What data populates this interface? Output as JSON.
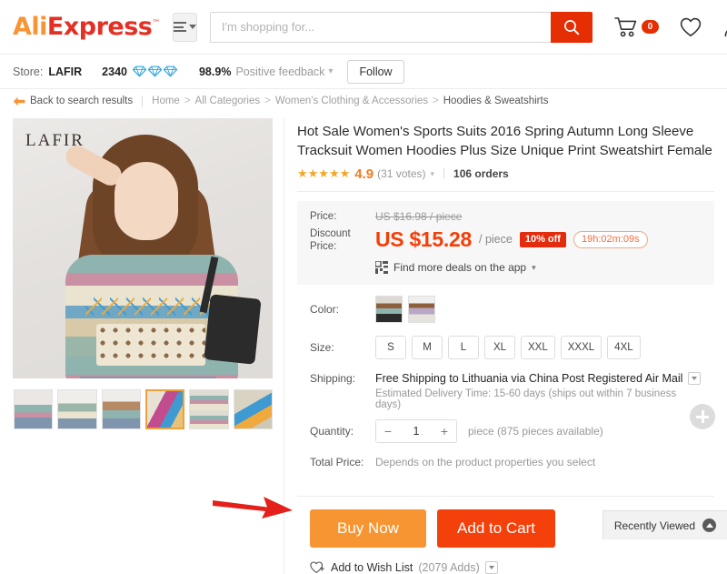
{
  "header": {
    "logo_ali": "Ali",
    "logo_express": "Express",
    "logo_tm": "™",
    "categories_icon": "hamburger-menu-icon",
    "search": {
      "placeholder": "I'm shopping for...",
      "value": "",
      "button_icon": "search-icon"
    },
    "cart": {
      "icon": "cart-icon",
      "count": "0"
    },
    "wishlist_icon": "heart-icon",
    "account_icon": "user-icon"
  },
  "store_bar": {
    "store_label": "Store:",
    "store_name": "LAFIR",
    "score": "2340",
    "diamond_icon": "diamond-icon",
    "diamond_count": 3,
    "feedback_percent": "98.9%",
    "feedback_text": "Positive feedback",
    "feedback_caret": "chevron-down-icon",
    "follow_label": "Follow"
  },
  "breadcrumb": {
    "back_icon": "back-arrow-icon",
    "back_label": "Back to search results",
    "items": [
      {
        "label": "Home"
      },
      {
        "label": "All Categories"
      },
      {
        "label": "Women's Clothing & Accessories"
      },
      {
        "label": "Hoodies & Sweatshirts"
      }
    ],
    "separator": ">"
  },
  "gallery": {
    "watermark": "LAFIR",
    "main_image_alt": "woman-wearing-striped-print-sweatshirt",
    "thumbnails": [
      {
        "name": "thumb-model-front",
        "selected": false
      },
      {
        "name": "thumb-model-sunglasses",
        "selected": false
      },
      {
        "name": "thumb-model-side",
        "selected": false
      },
      {
        "name": "thumb-fabric-detail",
        "selected": true
      },
      {
        "name": "thumb-flatlay-sweatshirt",
        "selected": false
      },
      {
        "name": "thumb-print-closeup",
        "selected": false
      }
    ]
  },
  "product": {
    "title": "Hot Sale Women's Sports Suits 2016 Spring Autumn Long Sleeve Tracksuit Women Hoodies Plus Size Unique Print Sweatshirt Female",
    "stars": "★★★★★",
    "rating": "4.9",
    "votes": "(31 votes)",
    "votes_caret": "chevron-down-icon",
    "orders": "106 orders",
    "price": {
      "price_label": "Price:",
      "original": "US $16.98 / piece",
      "discount_label_line1": "Discount",
      "discount_label_line2": "Price:",
      "amount": "US $15.28",
      "unit": "/ piece",
      "off_badge": "10% off",
      "countdown": "19h:02m:09s",
      "app_deal_icon": "qr-code-icon",
      "app_deal_text": "Find more deals on the app",
      "app_deal_caret": "caret-down-icon"
    },
    "color": {
      "label": "Color:",
      "options": [
        {
          "name": "color-swatch-dark-bag"
        },
        {
          "name": "color-swatch-light"
        }
      ]
    },
    "size": {
      "label": "Size:",
      "options": [
        "S",
        "M",
        "L",
        "XL",
        "XXL",
        "XXXL",
        "4XL"
      ]
    },
    "shipping": {
      "label": "Shipping:",
      "method": "Free Shipping to Lithuania via China Post Registered Air Mail",
      "dropdown_icon": "chevron-down-icon",
      "estimate": "Estimated Delivery Time: 15-60 days (ships out within 7 business days)"
    },
    "quantity": {
      "label": "Quantity:",
      "minus_icon": "minus-icon",
      "value": "1",
      "plus_icon": "plus-icon",
      "availability": "piece (875 pieces available)"
    },
    "total_price": {
      "label": "Total Price:",
      "value": "Depends on the product properties you select"
    },
    "actions": {
      "buy_now": "Buy Now",
      "add_to_cart": "Add to Cart",
      "wish_icon": "heart-plus-icon",
      "wish_label": "Add to Wish List",
      "wish_count": "(2079 Adds)",
      "wish_caret_icon": "chevron-down-icon"
    }
  },
  "floating": {
    "expand_button_icon": "plus-icon"
  },
  "recently_viewed": {
    "label": "Recently Viewed",
    "toggle_icon": "chevron-up-icon"
  },
  "annotation": {
    "arrow_icon": "red-pointer-arrow",
    "color": "#e3201a"
  },
  "colors": {
    "brand_orange": "#f79433",
    "brand_red": "#e42f25",
    "price_red": "#f43f09",
    "buy_now_orange": "#f79533",
    "add_cart_red": "#f4400a",
    "panel_gray": "#f7f7f7"
  }
}
